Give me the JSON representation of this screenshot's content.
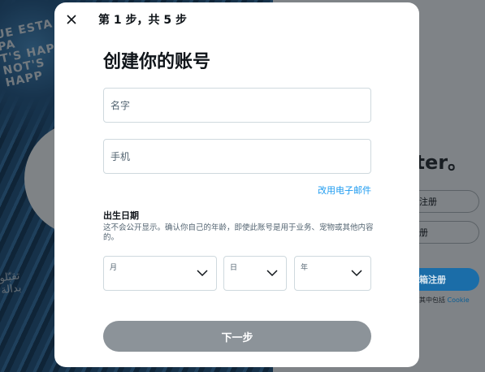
{
  "background": {
    "poster_text": "UE ESTA PA\nT'S HAPP\nNOT'S HAPP",
    "brand_fragment": "tter。",
    "signup_buttons": [
      "注册",
      "册",
      "箱注册"
    ],
    "note_prefix": "其中包括",
    "note_link": "Cookie"
  },
  "modal": {
    "step_label": "第 1 步，共 5 步",
    "title": "创建你的账号",
    "name_placeholder": "名字",
    "phone_placeholder": "手机",
    "use_email_link": "改用电子邮件",
    "dob_title": "出生日期",
    "dob_description": "这不会公开显示。确认你自己的年龄，即使此账号是用于业务、宠物或其他内容的。",
    "month_label": "月",
    "day_label": "日",
    "year_label": "年",
    "next_button": "下一步"
  },
  "colors": {
    "accent": "#1d9bf0",
    "disabled_button": "#8c9399",
    "border": "#cfd9de"
  }
}
